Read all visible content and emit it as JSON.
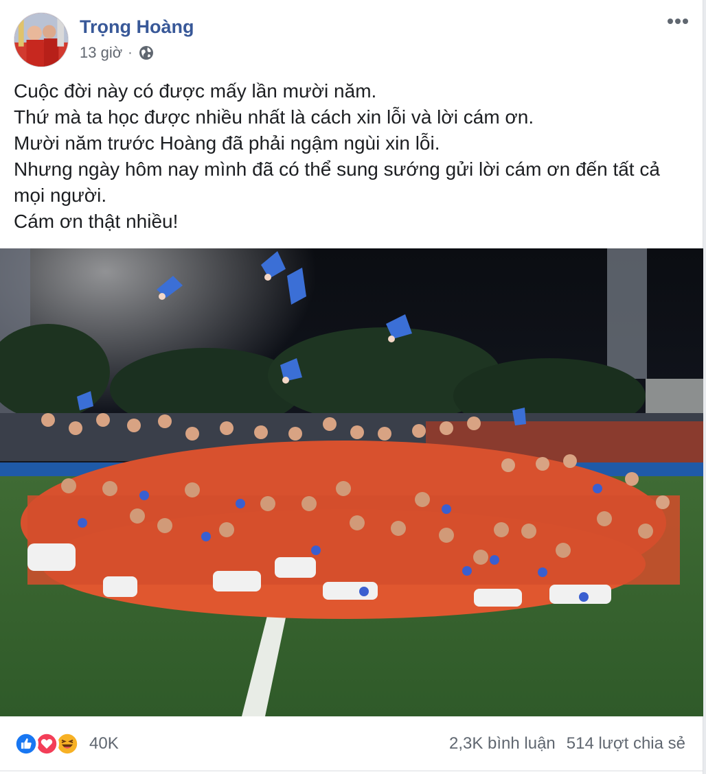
{
  "post": {
    "author": "Trọng Hoàng",
    "time": "13 giờ",
    "separator": "·",
    "privacy_icon": "globe-icon",
    "more_icon": "more-options-icon",
    "message_lines": [
      "Cuộc đời này có được mấy lần mười năm.",
      "Thứ mà ta học được nhiều nhất là cách xin lỗi và lời cám ơn.",
      "Mười năm trước Hoàng đã phải ngậm ngùi xin lỗi.",
      "Nhưng ngày hôm nay mình đã có thể sung sướng gửi lời cám ơn đến tất cả mọi người.",
      "Cám ơn thật nhiều!"
    ]
  },
  "stats": {
    "reaction_icons": [
      "like-icon",
      "love-icon",
      "haha-icon"
    ],
    "reaction_count": "40K",
    "comments": "2,3K bình luận",
    "shares": "514 lượt chia sẻ"
  },
  "colors": {
    "author_link": "#385898",
    "text": "#1c1e21",
    "secondary": "#616770",
    "like": "#1877f2",
    "love": "#f33e58",
    "haha": "#f7b125"
  }
}
